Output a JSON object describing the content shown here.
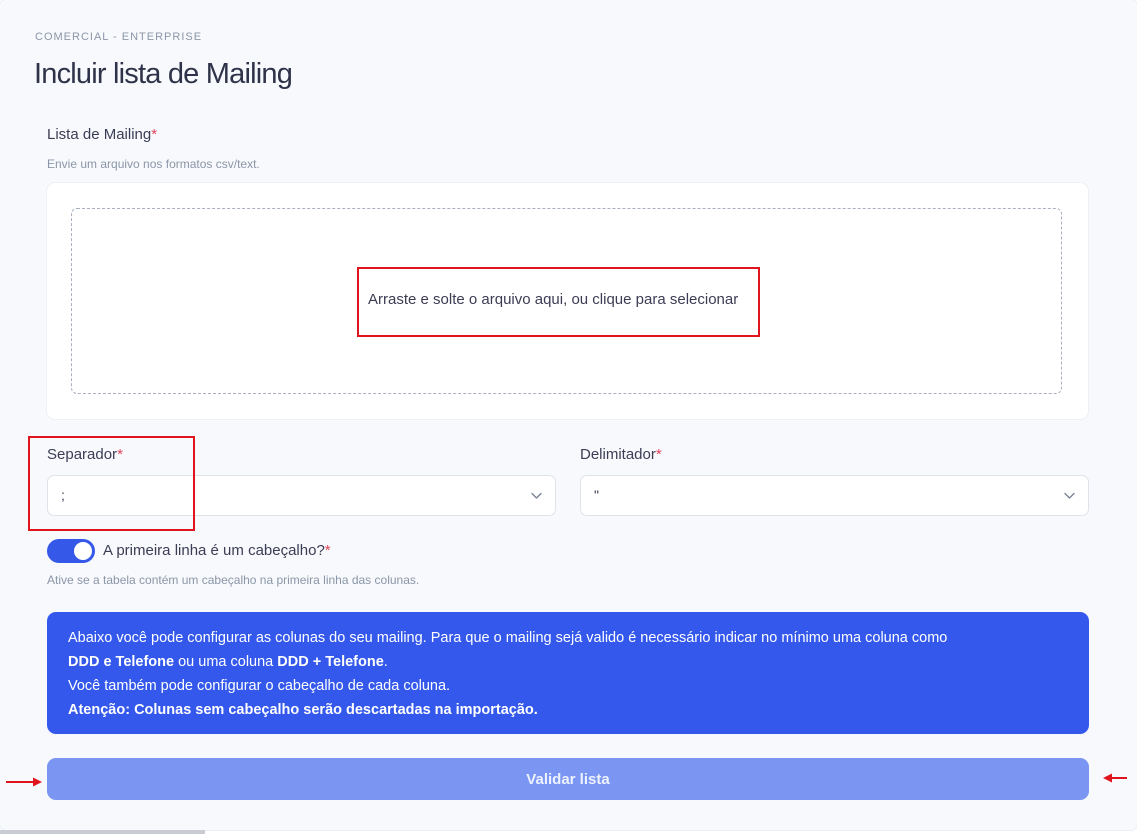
{
  "breadcrumb": "COMERCIAL - ENTERPRISE",
  "page_title": "Incluir lista de Mailing",
  "mailing_field": {
    "label": "Lista de Mailing",
    "required_mark": "*",
    "hint": "Envie um arquivo nos formatos csv/text.",
    "dropzone_text": "Arraste e solte o arquivo aqui, ou clique para selecionar"
  },
  "separator_field": {
    "label": "Separador",
    "required_mark": "*",
    "value": ";"
  },
  "delimiter_field": {
    "label": "Delimitador",
    "required_mark": "*",
    "value": "\""
  },
  "header_toggle": {
    "label": "A primeira linha é um cabeçalho?",
    "required_mark": "*",
    "checked": true,
    "hint": "Ative se a tabela contém um cabeçalho na primeira linha das colunas."
  },
  "info_box": {
    "line1_text": "Abaixo você pode configurar as colunas do seu mailing. Para que o mailing sejá valido é necessário indicar no mínimo uma coluna como",
    "line2_bold1": "DDD e Telefone",
    "line2_text": " ou uma coluna ",
    "line2_bold2": "DDD + Telefone",
    "line2_end": ".",
    "line3_text": "Você também pode configurar o cabeçalho de cada coluna.",
    "line4_bold": "Atenção: Colunas sem cabeçalho serão descartadas na importação."
  },
  "validate_button": {
    "label": "Validar lista"
  },
  "colors": {
    "accent": "#3358eb",
    "button_disabled": "#7b95f2",
    "required": "#e0445a",
    "annotation": "#e0141c"
  },
  "icons": {
    "select_chevron": "chevron-down-icon",
    "annotation_arrow": "arrow-icon"
  }
}
